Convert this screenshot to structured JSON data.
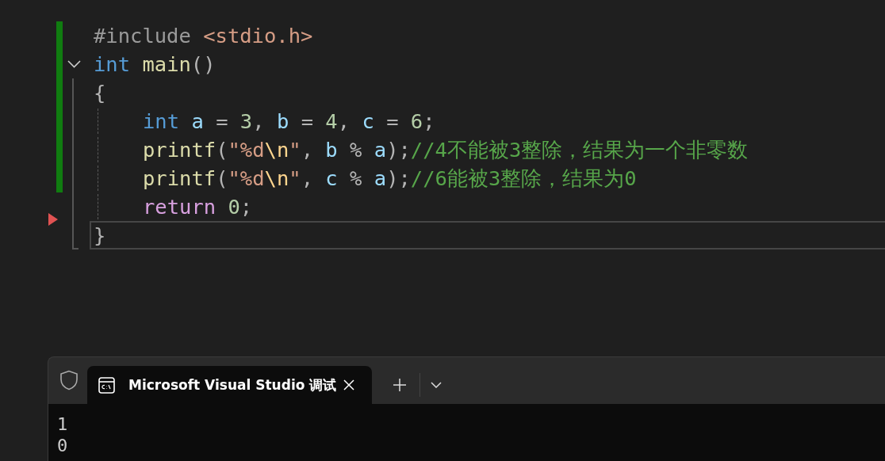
{
  "editor": {
    "lines": [
      {
        "changed": true,
        "current": false,
        "tokens": [
          {
            "kind": "preproc",
            "text": "#include "
          },
          {
            "kind": "string",
            "text": "<stdio.h>"
          }
        ]
      },
      {
        "changed": true,
        "current": false,
        "foldable": true,
        "tokens": [
          {
            "kind": "keyword",
            "text": "int "
          },
          {
            "kind": "function",
            "text": "main"
          },
          {
            "kind": "punct",
            "text": "()"
          }
        ]
      },
      {
        "changed": true,
        "current": false,
        "tokens": [
          {
            "kind": "punct",
            "text": "{"
          }
        ]
      },
      {
        "changed": true,
        "current": false,
        "indented": true,
        "tokens": [
          {
            "kind": "keyword",
            "text": "int "
          },
          {
            "kind": "variable",
            "text": "a"
          },
          {
            "kind": "punct",
            "text": " = "
          },
          {
            "kind": "number",
            "text": "3"
          },
          {
            "kind": "punct",
            "text": ", "
          },
          {
            "kind": "variable",
            "text": "b"
          },
          {
            "kind": "punct",
            "text": " = "
          },
          {
            "kind": "number",
            "text": "4"
          },
          {
            "kind": "punct",
            "text": ", "
          },
          {
            "kind": "variable",
            "text": "c"
          },
          {
            "kind": "punct",
            "text": " = "
          },
          {
            "kind": "number",
            "text": "6"
          },
          {
            "kind": "punct",
            "text": ";"
          }
        ]
      },
      {
        "changed": true,
        "current": false,
        "indented": true,
        "tokens": [
          {
            "kind": "function",
            "text": "printf"
          },
          {
            "kind": "punct",
            "text": "("
          },
          {
            "kind": "string",
            "text": "\"%d"
          },
          {
            "kind": "escape",
            "text": "\\n"
          },
          {
            "kind": "string",
            "text": "\""
          },
          {
            "kind": "punct",
            "text": ", "
          },
          {
            "kind": "variable",
            "text": "b"
          },
          {
            "kind": "punct",
            "text": " % "
          },
          {
            "kind": "variable",
            "text": "a"
          },
          {
            "kind": "punct",
            "text": ");"
          },
          {
            "kind": "comment",
            "text": "//4不能被3整除，结果为一个非零数"
          }
        ]
      },
      {
        "changed": true,
        "current": false,
        "indented": true,
        "tokens": [
          {
            "kind": "function",
            "text": "printf"
          },
          {
            "kind": "punct",
            "text": "("
          },
          {
            "kind": "string",
            "text": "\"%d"
          },
          {
            "kind": "escape",
            "text": "\\n"
          },
          {
            "kind": "string",
            "text": "\""
          },
          {
            "kind": "punct",
            "text": ", "
          },
          {
            "kind": "variable",
            "text": "c"
          },
          {
            "kind": "punct",
            "text": " % "
          },
          {
            "kind": "variable",
            "text": "a"
          },
          {
            "kind": "punct",
            "text": ");"
          },
          {
            "kind": "comment",
            "text": "//6能被3整除，结果为0"
          }
        ]
      },
      {
        "changed": false,
        "current": false,
        "indented": true,
        "tokens": [
          {
            "kind": "control",
            "text": "return "
          },
          {
            "kind": "number",
            "text": "0"
          },
          {
            "kind": "punct",
            "text": ";"
          }
        ]
      },
      {
        "changed": false,
        "current": true,
        "tokens": [
          {
            "kind": "punct",
            "text": "}"
          }
        ]
      }
    ]
  },
  "terminal": {
    "tabs": [
      {
        "title": "Microsoft Visual Studio 调试",
        "selected": true
      }
    ],
    "output": [
      "1",
      "0"
    ]
  }
}
